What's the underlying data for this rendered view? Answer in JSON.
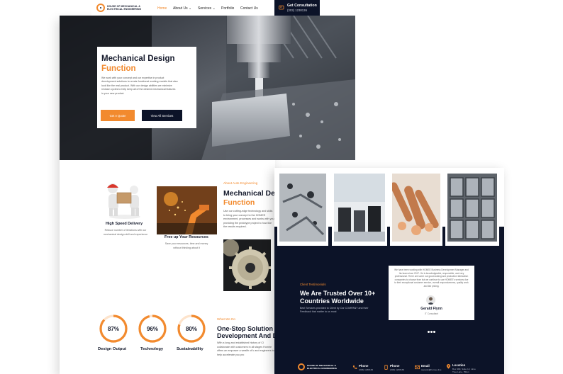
{
  "nav": {
    "logo_line1": "HOUSE OF MECHANICAL &",
    "logo_line2": "ELECTRICAL ENGINEERING",
    "links": [
      {
        "label": "Home",
        "active": true
      },
      {
        "label": "About Us"
      },
      {
        "label": "Services"
      },
      {
        "label": "Portfolio"
      },
      {
        "label": "Contact Us"
      }
    ],
    "cta_title": "Get Consultation",
    "cta_phone": "(303) 1238136",
    "phone_icon": "phone-icon"
  },
  "hero": {
    "title_line1": "Mechanical Design",
    "title_line2": "Function",
    "body": "We work with your concept and our expertise in product development solutions to create functional working models that also look like the real product. With our design abilities we minimize revision cycles to help keep all of the desired mechanical features in your new product.",
    "primary_button": "Get A Quote",
    "secondary_button": "View All Services"
  },
  "features": [
    {
      "title": "High Speed Delivery",
      "desc": "Reduce number of iterations with our mechanical design skill and experience"
    },
    {
      "title": "Free up Your Resources",
      "desc": "Save your resources, time and money without thinking about it"
    }
  ],
  "about": {
    "tag": "About Auto Engineering",
    "title_line1": "Mechanical Design",
    "title_line2": "Function",
    "body": "Use our cutting-edge technology and skills to bring your concept to the HOMEE environment, processes and works with you providing the prototype project to how like the results required."
  },
  "stats": [
    {
      "value": "87%",
      "label": "Design Output",
      "fraction": 0.87
    },
    {
      "value": "96%",
      "label": "Technology",
      "fraction": 0.96
    },
    {
      "value": "80%",
      "label": "Sustainability",
      "fraction": 0.8
    }
  ],
  "what": {
    "tag": "What We Do",
    "title_line1": "One-Stop Solution On",
    "title_line2": "Development And De",
    "body": "With a long and established history of Cl collaborate with customers in all stages Homee offers an empower a wealth of k and engineers to help accelerate you pro"
  },
  "testimonials": {
    "tag": "Client Testimonials",
    "title_line1": "We Are Trusted Over 10+",
    "title_line2": "Countries Worldwide",
    "body": "Best Services provided to Client by Our COMPANY and their Feedback that matter to us most",
    "quote": "We have been working with HOMEE Business Development Manager and his team since 2017. He is knowledgeable, responsible, and very professional. There are some our good-looking and production fabrication companies to choose from but we continue to use HOMEE's services due to their exceptional customer service, overall responsiveness, quality work and fair pricing.",
    "name": "Gerald Flynn",
    "role": "IT Consultant"
  },
  "footer": {
    "logo_line1": "HOUSE OF MECHANICAL &",
    "logo_line2": "ELECTRICAL ENGINEERING",
    "contacts": [
      {
        "title": "Phone",
        "line1": "(303) 1238136",
        "icon": "phone-icon"
      },
      {
        "title": "Phone",
        "line1": "(303) 1238136",
        "icon": "mobile-icon"
      },
      {
        "title": "Email",
        "line1": "support@homee.live",
        "icon": "mail-icon"
      },
      {
        "title": "Location",
        "line1": "Box 999, Suite 12, Lime",
        "line2": "Tree Lane, Hilton",
        "icon": "location-icon"
      }
    ]
  },
  "colors": {
    "accent": "#f28a2e",
    "navy": "#0c1328"
  }
}
